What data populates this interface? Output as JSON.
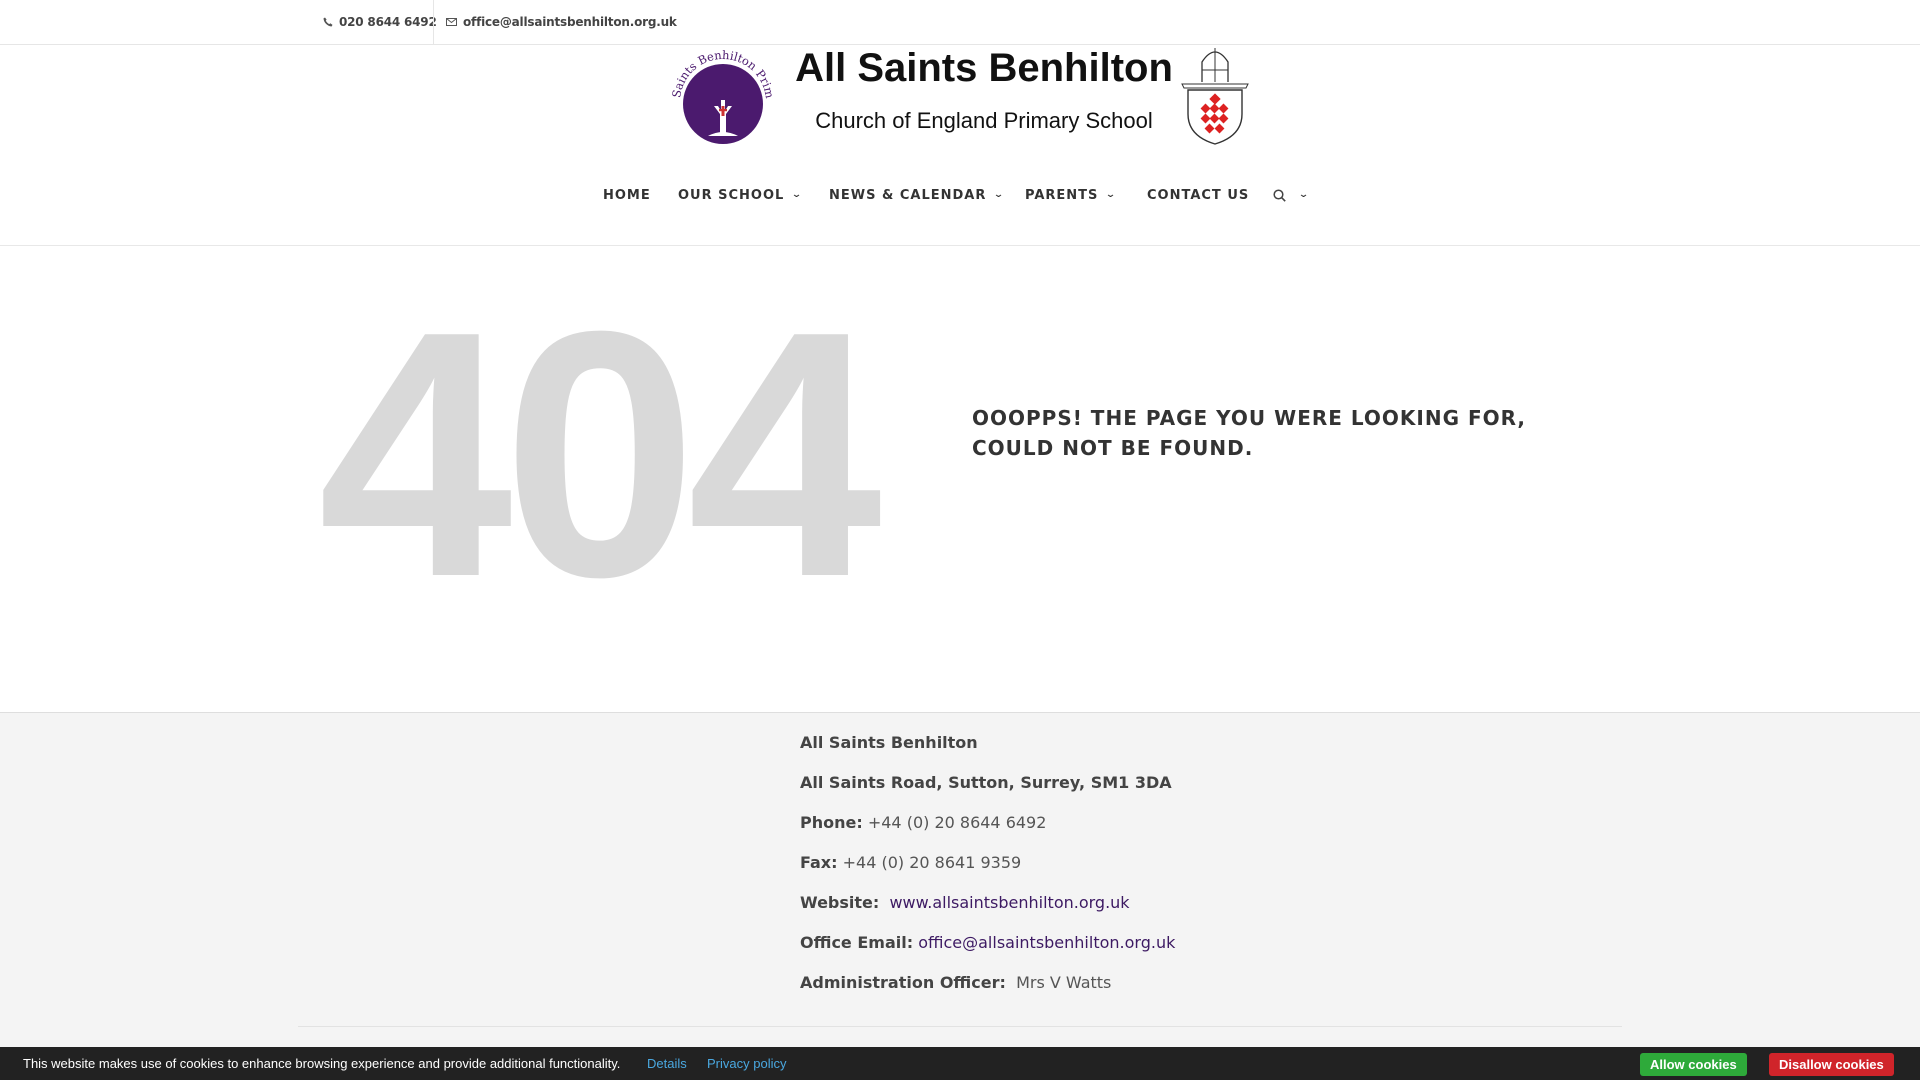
{
  "topbar": {
    "phone": "020 8644 6492",
    "email": "office@allsaintsbenhilton.org.uk"
  },
  "header": {
    "title": "All Saints Benhilton",
    "subtitle": "Church of England Primary School",
    "logo_text": "All Saints Benhilton Primary",
    "brand_color": "#4b1a6e"
  },
  "nav": {
    "items": [
      {
        "label": "HOME",
        "dropdown": false
      },
      {
        "label": "OUR SCHOOL",
        "dropdown": true
      },
      {
        "label": "NEWS & CALENDAR",
        "dropdown": true
      },
      {
        "label": "PARENTS",
        "dropdown": true
      },
      {
        "label": "CONTACT US",
        "dropdown": false
      }
    ],
    "search_icon": "search-icon"
  },
  "error": {
    "code": "404",
    "message": "OOOPPS! THE PAGE YOU WERE LOOKING FOR, COULD NOT BE FOUND."
  },
  "footer": {
    "name": "All Saints Benhilton",
    "address": "All Saints Road, Sutton, Surrey, SM1 3DA",
    "phone_label": "Phone:",
    "phone": "+44 (0) 20 8644 6492",
    "fax_label": "Fax:",
    "fax": "+44 (0) 20 8641 9359",
    "website_label": "Website:",
    "website": "www.allsaintsbenhilton.org.uk",
    "email_label": "Office Email:",
    "email": "office@allsaintsbenhilton.org.uk",
    "admin_label": "Administration Officer:",
    "admin": "Mrs V Watts"
  },
  "cookies": {
    "message": "This website makes use of cookies to enhance browsing experience and provide additional functionality.",
    "details": "Details",
    "privacy": "Privacy policy",
    "allow": "Allow cookies",
    "disallow": "Disallow cookies"
  }
}
